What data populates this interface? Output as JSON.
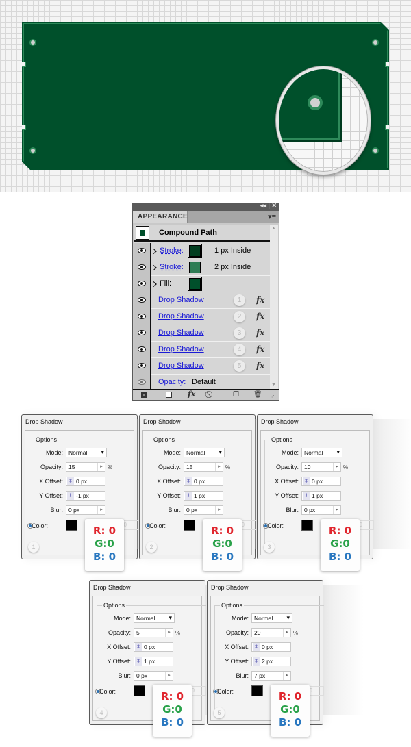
{
  "appearance_panel": {
    "tab_label": "APPEARANCE",
    "collapse_glyph": "◂◂",
    "close_glyph": "✕",
    "menu_glyph": "▾≡",
    "header_title": "Compound Path",
    "rows": [
      {
        "label": "Stroke:",
        "swatch_color": "#003d1f",
        "swatch_outlined": true,
        "detail": "1 px  Inside",
        "expandable": true
      },
      {
        "label": "Stroke:",
        "swatch_color": "#2e7d55",
        "swatch_outlined": false,
        "detail": "2 px  Inside",
        "expandable": true
      },
      {
        "label": "Fill:",
        "swatch_color": "#00502b",
        "swatch_outlined": true,
        "detail": "",
        "expandable": true
      },
      {
        "label": "Drop Shadow",
        "number": "1",
        "fx": "fx"
      },
      {
        "label": "Drop Shadow",
        "number": "2",
        "fx": "fx"
      },
      {
        "label": "Drop Shadow",
        "number": "3",
        "fx": "fx"
      },
      {
        "label": "Drop Shadow",
        "number": "4",
        "fx": "fx"
      },
      {
        "label": "Drop Shadow",
        "number": "5",
        "fx": "fx"
      },
      {
        "label": "Opacity:",
        "value": "Default"
      }
    ],
    "footer_fx": "fx"
  },
  "dialogs": [
    {
      "title": "Drop Shadow",
      "group": "Options",
      "mode_label": "Mode:",
      "mode": "Normal",
      "opacity_label": "Opacity:",
      "opacity": "15",
      "pct": "%",
      "x_label": "X Offset:",
      "x_offset": "0 px",
      "y_label": "Y Offset:",
      "y_offset": "-1 px",
      "blur_label": "Blur:",
      "blur": "0 px",
      "color_label": "Color:",
      "number": "1",
      "r": "R: 0",
      "g": "G:0",
      "b": "B: 0",
      "ghost": "00"
    },
    {
      "title": "Drop Shadow",
      "group": "Options",
      "mode_label": "Mode:",
      "mode": "Normal",
      "opacity_label": "Opacity:",
      "opacity": "15",
      "pct": "%",
      "x_label": "X Offset:",
      "x_offset": "0 px",
      "y_label": "Y Offset:",
      "y_offset": "1 px",
      "blur_label": "Blur:",
      "blur": "0 px",
      "color_label": "Color:",
      "number": "2",
      "r": "R: 0",
      "g": "G:0",
      "b": "B: 0",
      "ghost": "00"
    },
    {
      "title": "Drop Shadow",
      "group": "Options",
      "mode_label": "Mode:",
      "mode": "Normal",
      "opacity_label": "Opacity:",
      "opacity": "10",
      "pct": "%",
      "x_label": "X Offset:",
      "x_offset": "0 px",
      "y_label": "Y Offset:",
      "y_offset": "1 px",
      "blur_label": "Blur:",
      "blur": "0 px",
      "color_label": "Color:",
      "number": "3",
      "r": "R: 0",
      "g": "G:0",
      "b": "B: 0",
      "ghost": "00"
    },
    {
      "title": "Drop Shadow",
      "group": "Options",
      "mode_label": "Mode:",
      "mode": "Normal",
      "opacity_label": "Opacity:",
      "opacity": "5",
      "pct": "%",
      "x_label": "X Offset:",
      "x_offset": "0 px",
      "y_label": "Y Offset:",
      "y_offset": "1 px",
      "blur_label": "Blur:",
      "blur": "0 px",
      "color_label": "Color:",
      "number": "4",
      "r": "R: 0",
      "g": "G:0",
      "b": "B: 0",
      "ghost": "00"
    },
    {
      "title": "Drop Shadow",
      "group": "Options",
      "mode_label": "Mode:",
      "mode": "Normal",
      "opacity_label": "Opacity:",
      "opacity": "20",
      "pct": "%",
      "x_label": "X Offset:",
      "x_offset": "0 px",
      "y_label": "Y Offset:",
      "y_offset": "2 px",
      "blur_label": "Blur:",
      "blur": "7 px",
      "color_label": "Color:",
      "number": "5",
      "r": "R: 0",
      "g": "G:0",
      "b": "B: 0",
      "ghost": "00"
    }
  ],
  "colors": {
    "board_fill": "#00502b",
    "board_stroke": "#2e8a5a",
    "shadow_color": "#000000"
  }
}
